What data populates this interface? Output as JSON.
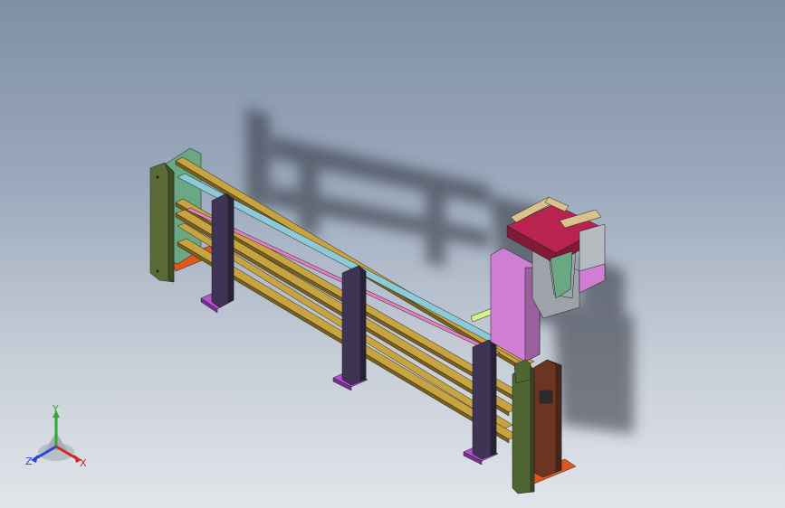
{
  "viewport": {
    "background_top": "#7f8fa6",
    "background_bottom": "#e2e5ea"
  },
  "model": {
    "colors": {
      "end_plate_left": "#5b6b38",
      "end_plate_right": "#4f6531",
      "left_bracket": "#6aa884",
      "right_block": "#6b3522",
      "rail": "#c8a441",
      "rail_dark": "#7a6020",
      "rod_blue": "#8ec9d8",
      "rod_pink": "#e57fc2",
      "support_leg": "#3d3553",
      "leg_foot": "#b84fd8",
      "base_orange": "#e0561f",
      "carriage_plate": "#cf7fd3",
      "carriage_top": "#b8234f",
      "carriage_wood": "#d9c38a",
      "carriage_side": "#9da3a8",
      "shadow": "#2b2f38",
      "cylinder": "#d6f08a"
    },
    "support_leg_count": 3
  },
  "triad": {
    "x_label": "X",
    "y_label": "Y",
    "z_label": "Z",
    "x_color": "#d22727",
    "y_color": "#2faa2f",
    "z_color": "#2a46d6"
  }
}
